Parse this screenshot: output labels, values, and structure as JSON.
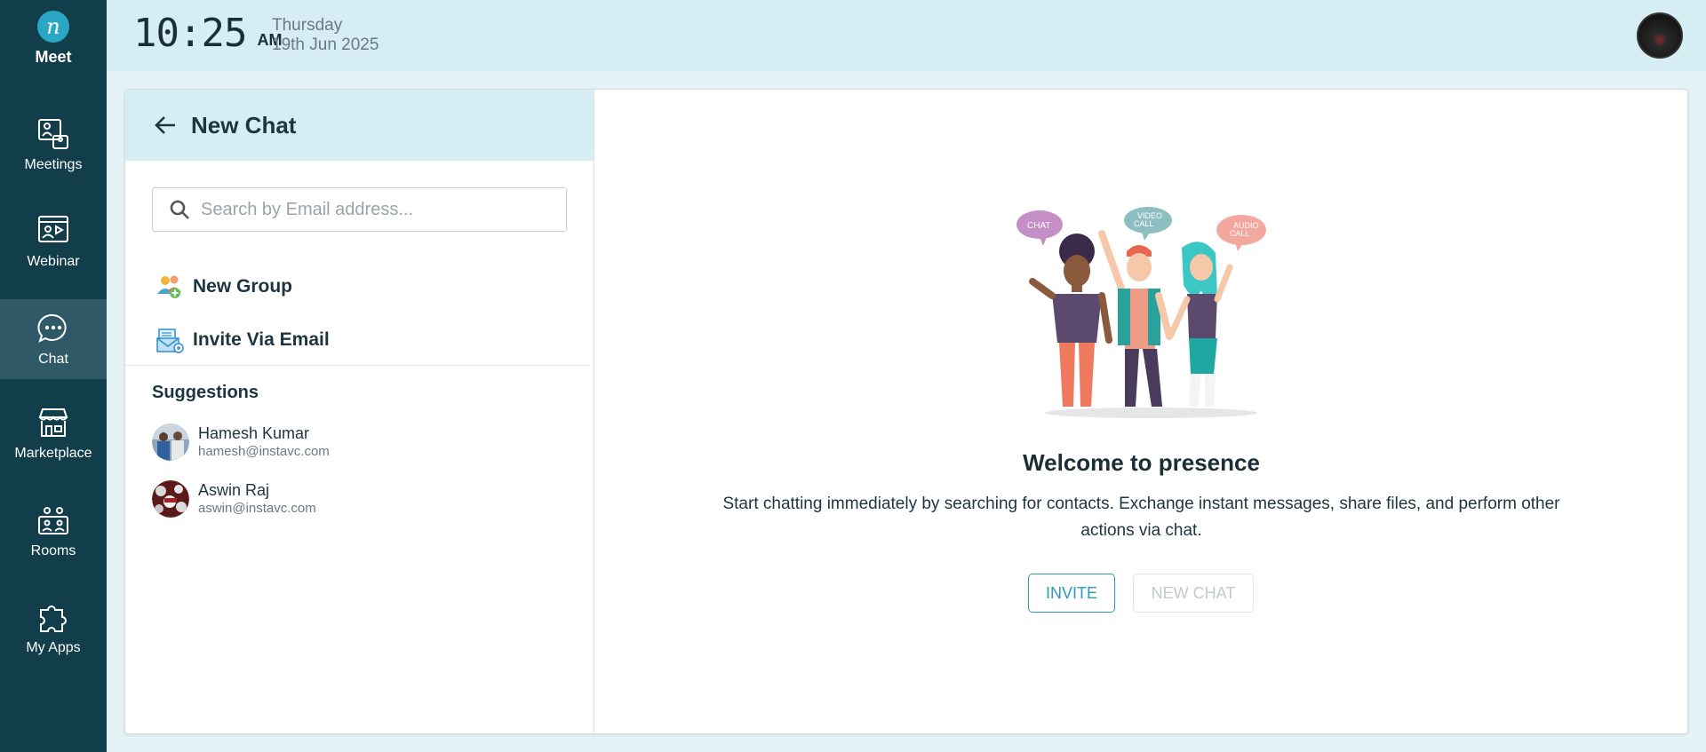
{
  "app": {
    "logo_text": "Meet",
    "logo_glyph": "n"
  },
  "sidebar": {
    "items": [
      {
        "label": "Meetings",
        "icon": "meetings-icon",
        "active": false
      },
      {
        "label": "Webinar",
        "icon": "webinar-icon",
        "active": false
      },
      {
        "label": "Chat",
        "icon": "chat-icon",
        "active": true
      },
      {
        "label": "Marketplace",
        "icon": "marketplace-icon",
        "active": false
      },
      {
        "label": "Rooms",
        "icon": "rooms-icon",
        "active": false
      },
      {
        "label": "My Apps",
        "icon": "puzzle-icon",
        "active": false
      }
    ]
  },
  "topbar": {
    "time": "10:25",
    "ampm": "AM",
    "day": "Thursday",
    "date": "19th Jun 2025"
  },
  "left_panel": {
    "title": "New Chat",
    "search": {
      "placeholder": "Search by Email address...",
      "value": ""
    },
    "actions": [
      {
        "label": "New Group",
        "icon": "group-icon"
      },
      {
        "label": "Invite Via Email",
        "icon": "email-icon"
      }
    ],
    "suggestions_title": "Suggestions",
    "suggestions": [
      {
        "name": "Hamesh Kumar",
        "email": "hamesh@instavc.com"
      },
      {
        "name": "Aswin Raj",
        "email": "aswin@instavc.com"
      }
    ]
  },
  "right_panel": {
    "bubbles": {
      "chat": "CHAT",
      "video_1": "VIDEO",
      "video_2": "CALL",
      "audio_1": "AUDIO",
      "audio_2": "CALL"
    },
    "title": "Welcome to presence",
    "description": "Start chatting immediately by searching for contacts. Exchange instant messages, share files, and perform other actions via chat.",
    "invite_label": "INVITE",
    "new_chat_label": "NEW CHAT"
  },
  "colors": {
    "sidebar_bg": "#123d4a",
    "sidebar_active": "#2f5967",
    "topbar_bg": "#d6edf3",
    "accent": "#2a9bb8"
  }
}
